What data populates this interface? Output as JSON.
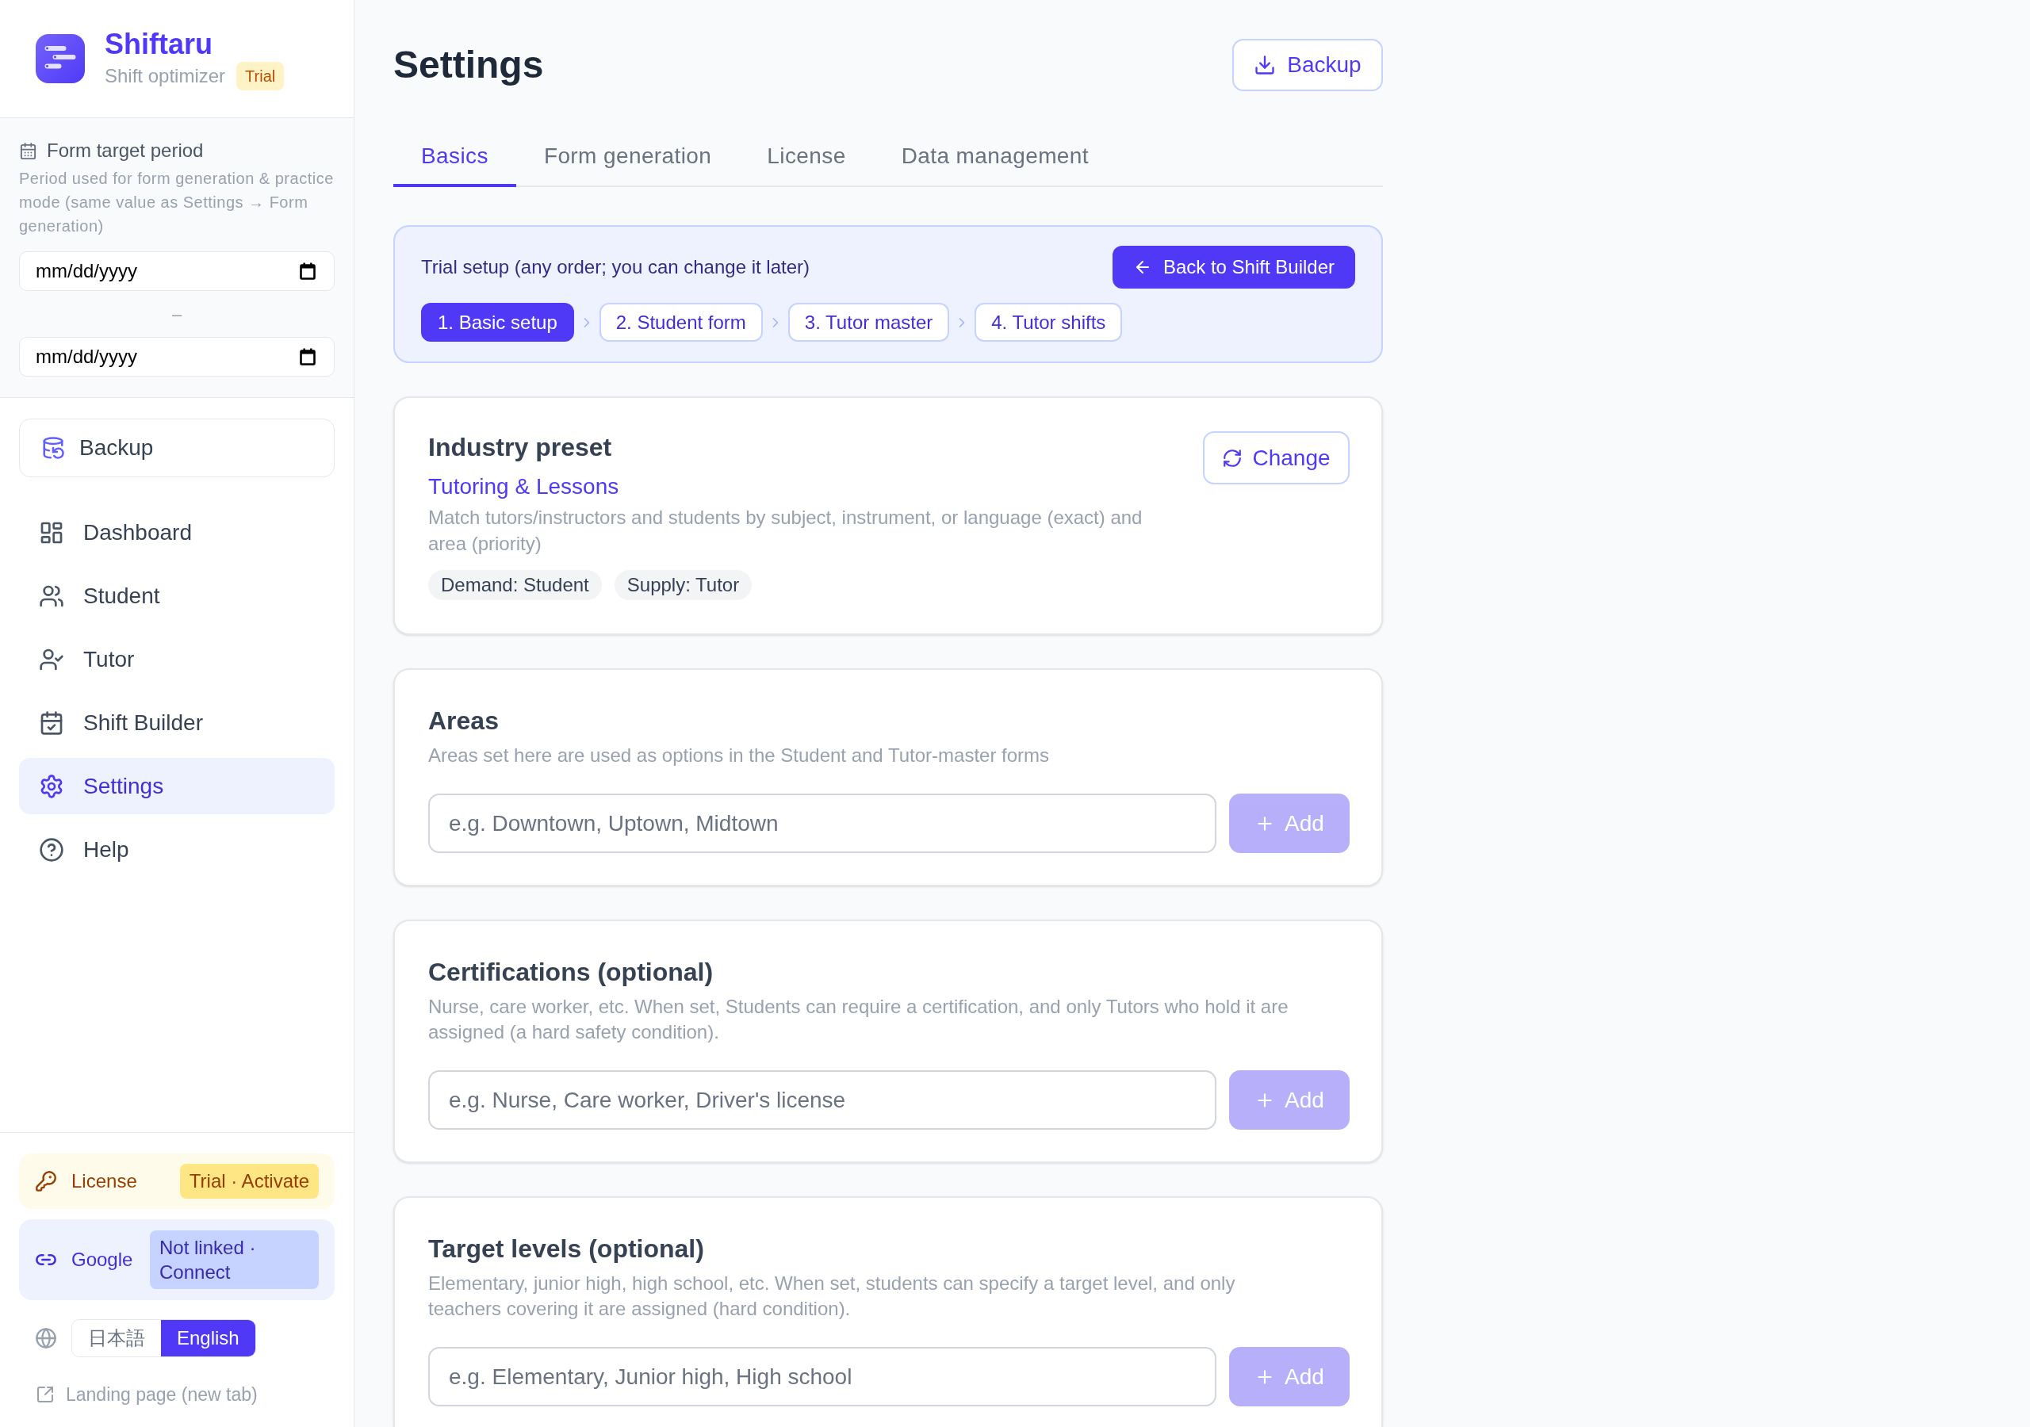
{
  "sidebar": {
    "brand": {
      "name": "Shiftaru",
      "subtitle": "Shift optimizer",
      "badge": "Trial"
    },
    "period": {
      "label": "Form target period",
      "description": "Period used for form generation & practice mode (same value as Settings → Form generation)",
      "start_date": {
        "placeholder": "mm/dd/yyyy"
      },
      "separator": "–",
      "end_date": {
        "placeholder": "mm/dd/yyyy"
      }
    },
    "backup_button": "Backup",
    "nav": [
      {
        "label": "Dashboard",
        "selected": false
      },
      {
        "label": "Student",
        "selected": false
      },
      {
        "label": "Tutor",
        "selected": false
      },
      {
        "label": "Shift Builder",
        "selected": false
      },
      {
        "label": "Settings",
        "selected": true
      },
      {
        "label": "Help",
        "selected": false
      }
    ],
    "license": {
      "label": "License",
      "status": "Trial · Activate"
    },
    "google": {
      "label": "Google",
      "status": "Not linked · Connect"
    },
    "languages": [
      {
        "label": "日本語",
        "selected": false
      },
      {
        "label": "English",
        "selected": true
      }
    ],
    "landing_link": "Landing page (new tab)"
  },
  "header": {
    "title": "Settings",
    "backup_button": "Backup"
  },
  "tabs": [
    {
      "label": "Basics",
      "selected": true
    },
    {
      "label": "Form generation",
      "selected": false
    },
    {
      "label": "License",
      "selected": false
    },
    {
      "label": "Data management",
      "selected": false
    }
  ],
  "trial_setup": {
    "title": "Trial setup (any order; you can change it later)",
    "back_button": "Back to Shift Builder",
    "steps": [
      {
        "label": "1. Basic setup",
        "selected": true
      },
      {
        "label": "2. Student form",
        "selected": false
      },
      {
        "label": "3. Tutor master",
        "selected": false
      },
      {
        "label": "4. Tutor shifts",
        "selected": false
      }
    ]
  },
  "industry_preset": {
    "title": "Industry preset",
    "preset": "Tutoring & Lessons",
    "description": "Match tutors/instructors and students by subject, instrument, or language (exact) and area (priority)",
    "tags": [
      "Demand: Student",
      "Supply: Tutor"
    ],
    "change_button": "Change"
  },
  "sections": [
    {
      "title": "Areas",
      "description": "Areas set here are used as options in the Student and Tutor-master forms",
      "input": {
        "placeholder": "e.g. Downtown, Uptown, Midtown"
      },
      "add_button": {
        "label": "Add",
        "disabled": true
      }
    },
    {
      "title": "Certifications (optional)",
      "description": "Nurse, care worker, etc. When set, Students can require a certification, and only Tutors who hold it are assigned (a hard safety condition).",
      "input": {
        "placeholder": "e.g. Nurse, Care worker, Driver's license"
      },
      "add_button": {
        "label": "Add",
        "disabled": true
      }
    },
    {
      "title": "Target levels (optional)",
      "description": "Elementary, junior high, high school, etc. When set, students can specify a target level, and only teachers covering it are assigned (hard condition).",
      "input": {
        "placeholder": "e.g. Elementary, Junior high, High school"
      },
      "add_button": {
        "label": "Add",
        "disabled": true
      }
    }
  ]
}
